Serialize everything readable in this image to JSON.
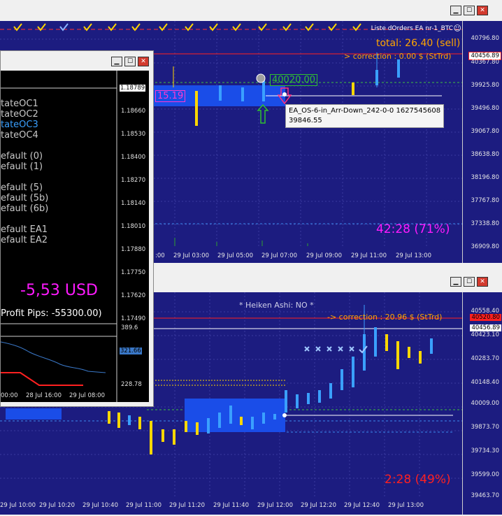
{
  "top_chart": {
    "header": "Liste dOrders EA nr-1_BTC",
    "total": "total: 26.40 (sell)",
    "correction": "> correction : 0.00 $ (StTrd)",
    "pct": "42:28 (71%)",
    "left_value": "15.19",
    "hl_price": "40020.00",
    "tooltip_line1": "EA_OS-6-in_Arr-Down_242-0-0 1627545608",
    "tooltip_line2": "39846.55",
    "price_red": "40456.89",
    "y_ticks": [
      "40796.80",
      "40367.80",
      "39925.80",
      "39496.80",
      "39067.80",
      "38638.80",
      "38196.80",
      "37767.80",
      "37338.80",
      "36909.80"
    ],
    "x_ticks": [
      "29 Jul 03:00",
      "29 Jul 05:00",
      "29 Jul 07:00",
      "29 Jul 09:00",
      "29 Jul 11:00",
      "29 Jul 13:00"
    ],
    "x_first": ":00"
  },
  "bottom_chart": {
    "heiken": "* Heiken Ashi: NO *",
    "correction": "-> correction : 20.96 $ (StTrd)",
    "pct": "2:28 (49%)",
    "price_red": "40520.80",
    "price_white": "40456.89",
    "y_ticks": [
      "40558.40",
      "40423.10",
      "40283.70",
      "40148.40",
      "40009.00",
      "39873.70",
      "39734.30",
      "39599.00",
      "39463.70"
    ],
    "x_ticks": [
      "29 Jul 10:00",
      "29 Jul 10:20",
      "29 Jul 10:40",
      "29 Jul 11:00",
      "29 Jul 11:20",
      "29 Jul 11:40",
      "29 Jul 12:00",
      "29 Jul 12:20",
      "29 Jul 12:40",
      "29 Jul 13:00"
    ]
  },
  "float_window": {
    "labels": [
      "tateOC1",
      "tateOC2",
      "tateOC3",
      "tateOC4",
      "efault (0)",
      "efault (1)",
      "efault (5)",
      "efault (5b)",
      "efault (6b)",
      "efault EA1",
      "efault EA2"
    ],
    "usd": "-5,53 USD",
    "profit": "Profit Pips: -55300.00)",
    "y_ticks": [
      "1.18789",
      "1.18660",
      "1.18530",
      "1.18400",
      "1.18270",
      "1.18140",
      "1.18010",
      "1.17880",
      "1.17750",
      "1.17620",
      "1.17490"
    ],
    "sub_ticks": [
      "389.6",
      "321.66",
      "228.78"
    ],
    "x_ticks": [
      "00:00",
      "28 Jul 16:00",
      "29 Jul 08:00"
    ]
  },
  "icons": [
    "minimize-icon",
    "maximize-icon",
    "close-icon"
  ],
  "colors": {
    "chart_bg": "#1c1c80",
    "pct": "#ff1aff",
    "total": "#ffa500",
    "red": "#ff2020"
  }
}
